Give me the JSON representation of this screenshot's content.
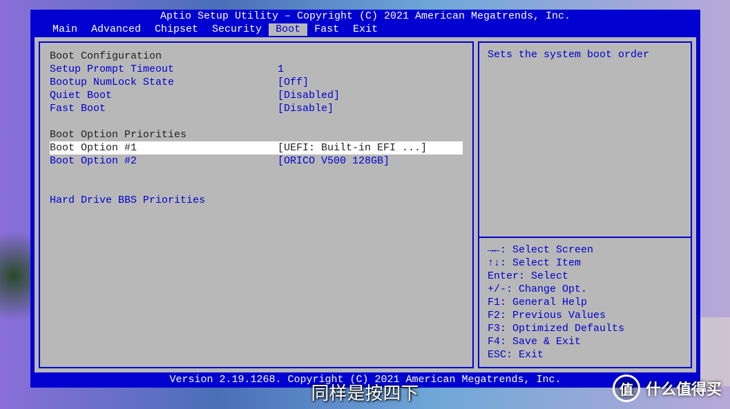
{
  "title": "Aptio Setup Utility – Copyright (C) 2021 American Megatrends, Inc.",
  "menu": {
    "items": [
      "Main",
      "Advanced",
      "Chipset",
      "Security",
      "Boot",
      "Fast",
      "Exit"
    ],
    "selected_index": 4
  },
  "boot": {
    "section1_header": "Boot Configuration",
    "setup_prompt_timeout": {
      "label": "Setup Prompt Timeout",
      "value": "1"
    },
    "bootup_numlock_state": {
      "label": "Bootup NumLock State",
      "value": "[Off]"
    },
    "quiet_boot": {
      "label": "Quiet Boot",
      "value": "[Disabled]"
    },
    "fast_boot": {
      "label": "Fast Boot",
      "value": "[Disable]"
    },
    "section2_header": "Boot Option Priorities",
    "boot_option_1": {
      "label": "Boot Option #1",
      "value": "[UEFI: Built-in EFI ...]"
    },
    "boot_option_2": {
      "label": "Boot Option #2",
      "value": "[ORICO V500 128GB]"
    },
    "hard_drive_bbs": "Hard Drive BBS Priorities"
  },
  "help": {
    "description": "Sets the system boot order",
    "keys": {
      "select_screen": "→←: Select Screen",
      "select_item": "↑↓: Select Item",
      "enter": "Enter: Select",
      "change": "+/-: Change Opt.",
      "f1": "F1: General Help",
      "f2": "F2: Previous Values",
      "f3": "F3: Optimized Defaults",
      "f4": "F4: Save & Exit",
      "esc": "ESC: Exit"
    }
  },
  "footer": "Version 2.19.1268. Copyright (C) 2021 American Megatrends, Inc.",
  "caption": "同样是按四下",
  "watermark": {
    "icon": "值",
    "text": "什么值得买"
  }
}
